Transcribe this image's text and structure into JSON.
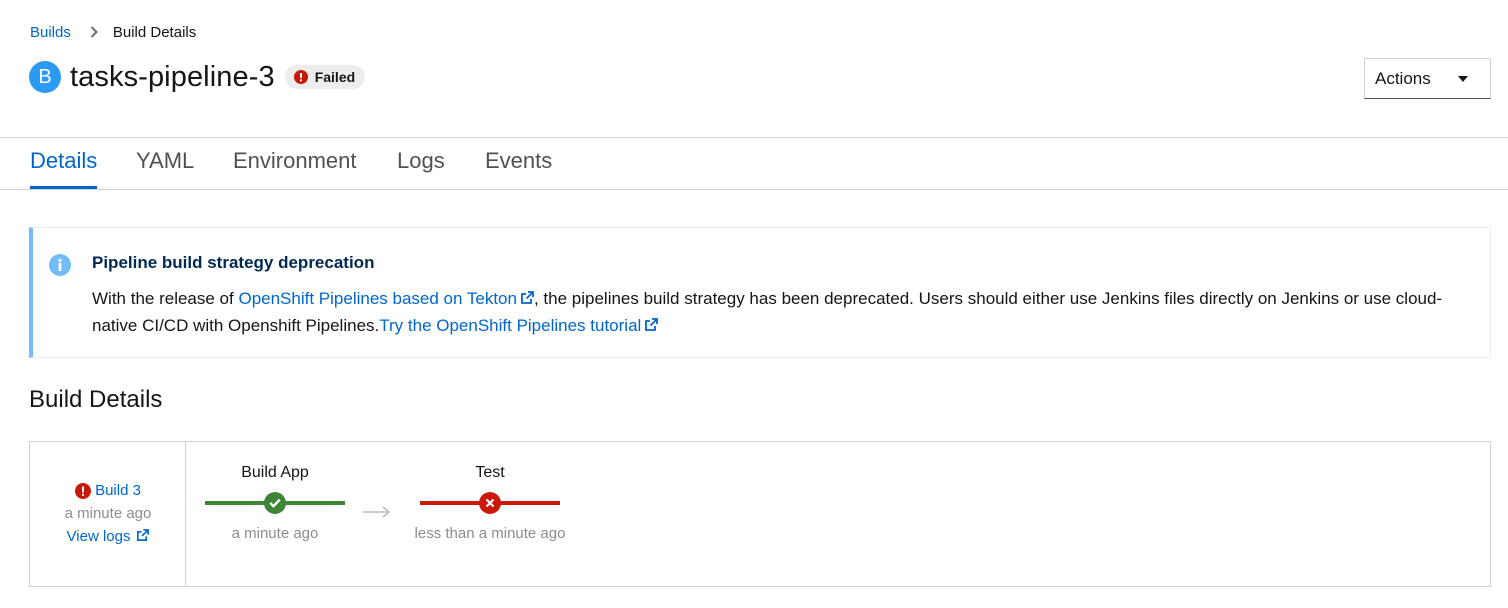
{
  "breadcrumb": {
    "parent": "Builds",
    "current": "Build Details"
  },
  "header": {
    "badge": "B",
    "title": "tasks-pipeline-3",
    "status": "Failed",
    "actions_label": "Actions"
  },
  "tabs": [
    {
      "label": "Details",
      "active": true
    },
    {
      "label": "YAML"
    },
    {
      "label": "Environment"
    },
    {
      "label": "Logs"
    },
    {
      "label": "Events"
    }
  ],
  "alert": {
    "title": "Pipeline build strategy deprecation",
    "text_1": "With the release of ",
    "link_1": "OpenShift Pipelines based on Tekton",
    "text_2": ", the pipelines build strategy has been deprecated. Users should either use Jenkins files directly on Jenkins or use cloud-native CI/CD with Openshift Pipelines.",
    "link_2": "Try the OpenShift Pipelines tutorial"
  },
  "section_title": "Build Details",
  "build": {
    "name": "Build 3",
    "time": "a minute ago",
    "view_logs": "View logs"
  },
  "stages": [
    {
      "name": "Build App",
      "status": "success",
      "time": "a minute ago"
    },
    {
      "name": "Test",
      "status": "failed",
      "time": "less than a minute ago"
    }
  ],
  "colors": {
    "link": "#0066cc",
    "success": "#3e8635",
    "danger": "#c9190b",
    "info": "#2b9af3"
  }
}
